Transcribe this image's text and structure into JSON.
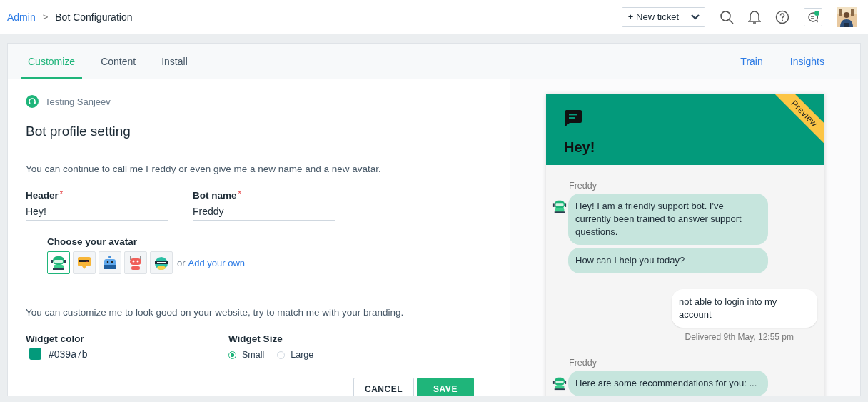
{
  "breadcrumb": {
    "parent": "Admin",
    "separator": ">",
    "current": "Bot Configuration"
  },
  "header_actions": {
    "new_ticket": "+ New ticket",
    "notification_dot": true
  },
  "tabs": [
    {
      "label": "Customize",
      "selected": true
    },
    {
      "label": "Content",
      "selected": false
    },
    {
      "label": "Install",
      "selected": false
    }
  ],
  "right_links": [
    "Train",
    "Insights"
  ],
  "bot_owner": "Testing Sanjeev",
  "section_title": "Bot profile setting",
  "intro": "You can continue to call me Freddy or even give me a new name and a new avatar.",
  "fields": [
    {
      "label": "Header",
      "required_mark": "*",
      "value": "Hey!"
    },
    {
      "label": "Bot name",
      "required_mark": "*",
      "value": "Freddy"
    }
  ],
  "avatar_picker": {
    "label": "Choose your avatar",
    "or": "or",
    "add_link": "Add your own",
    "avatars": [
      {
        "kind": "helmet",
        "selected": true
      },
      {
        "kind": "shades",
        "selected": false
      },
      {
        "kind": "box",
        "selected": false
      },
      {
        "kind": "antenna",
        "selected": false
      },
      {
        "kind": "dino",
        "selected": false
      }
    ]
  },
  "branding_intro": "You can customize me to look good on your website, try to match me with your branding.",
  "widget_color": {
    "label": "Widget color",
    "value": "#039a7b"
  },
  "widget_size": {
    "label": "Widget Size",
    "options": [
      {
        "label": "Small",
        "selected": true
      },
      {
        "label": "Large",
        "selected": false
      }
    ]
  },
  "buttons": [
    {
      "label": "CANCEL",
      "kind": "secondary"
    },
    {
      "label": "SAVE",
      "kind": "primary"
    }
  ],
  "preview": {
    "ribbon": "Preview",
    "title": "Hey!",
    "messages": [
      {
        "kind": "bot",
        "sender": "Freddy",
        "bubbles": [
          "Hey! I am a friendly support bot. I've currently been trained to answer support questions.",
          "How can I help you today?"
        ]
      },
      {
        "kind": "user",
        "bubbles": [
          "not able to login into my account"
        ],
        "status": "Delivered 9th May, 12:55 pm"
      },
      {
        "kind": "bot",
        "sender": "Freddy",
        "bubbles": [
          "Here are some recommendations for you: ..."
        ]
      }
    ]
  }
}
